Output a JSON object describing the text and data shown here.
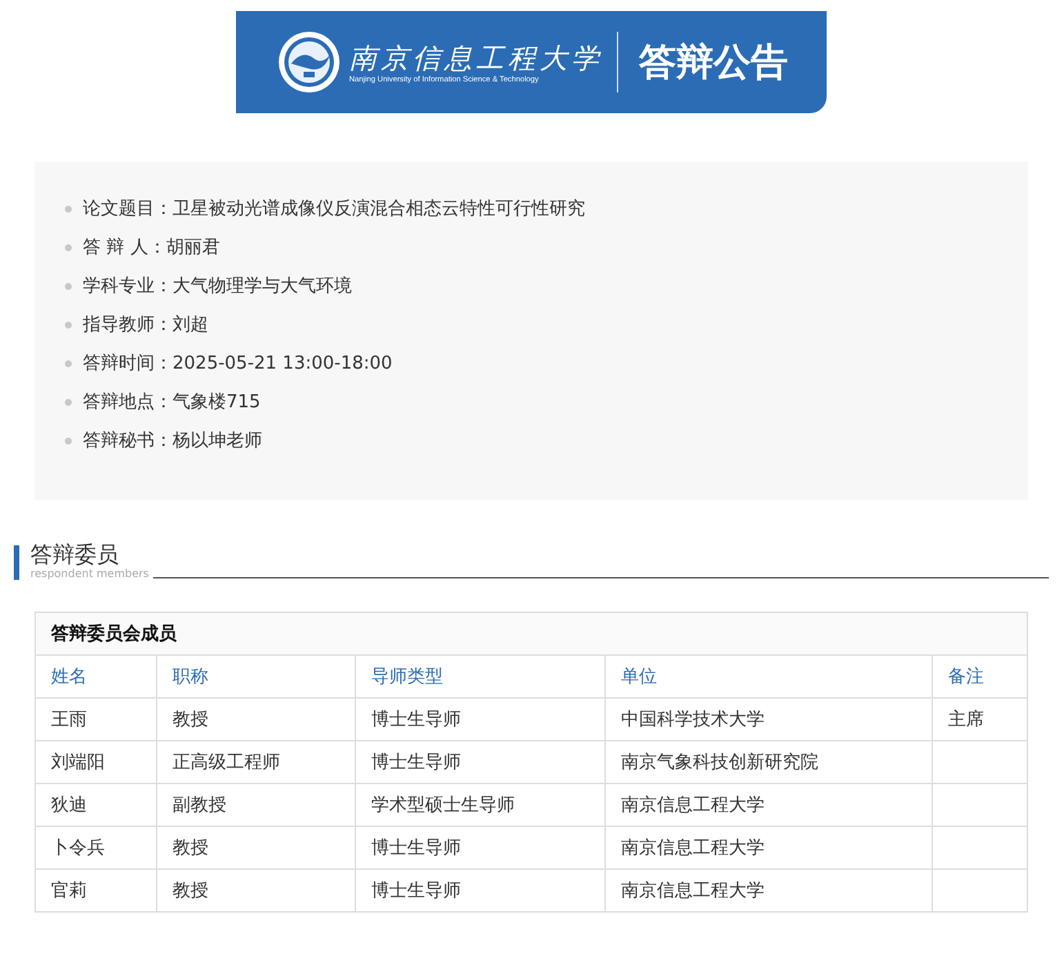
{
  "banner": {
    "school_name": "南京信息工程大学",
    "school_name_en": "Nanjing University of Information Science & Technology",
    "title": "答辩公告"
  },
  "info": [
    {
      "label": "论文题目：",
      "value": "卫星被动光谱成像仪反演混合相态云特性可行性研究"
    },
    {
      "label": "答 辩 人：",
      "value": "胡丽君"
    },
    {
      "label": "学科专业：",
      "value": "大气物理学与大气环境"
    },
    {
      "label": "指导教师：",
      "value": "刘超"
    },
    {
      "label": "答辩时间：",
      "value": "2025-05-21 13:00-18:00"
    },
    {
      "label": "答辩地点：",
      "value": "气象楼715"
    },
    {
      "label": "答辩秘书：",
      "value": "杨以坤老师"
    }
  ],
  "section": {
    "title": "答辩委员",
    "subtitle": "respondent members"
  },
  "table": {
    "caption": "答辩委员会成员",
    "columns": [
      "姓名",
      "职称",
      "导师类型",
      "单位",
      "备注"
    ],
    "rows": [
      [
        "王雨",
        "教授",
        "博士生导师",
        "中国科学技术大学",
        "主席"
      ],
      [
        "刘端阳",
        "正高级工程师",
        "博士生导师",
        "南京气象科技创新研究院",
        ""
      ],
      [
        "狄迪",
        "副教授",
        "学术型硕士生导师",
        "南京信息工程大学",
        ""
      ],
      [
        "卜令兵",
        "教授",
        "博士生导师",
        "南京信息工程大学",
        ""
      ],
      [
        "官莉",
        "教授",
        "博士生导师",
        "南京信息工程大学",
        ""
      ]
    ]
  }
}
